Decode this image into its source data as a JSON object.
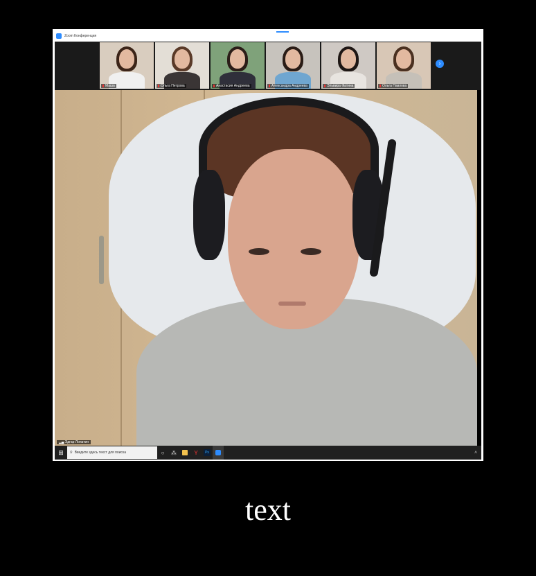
{
  "window": {
    "title": "Zoom Конференция"
  },
  "gallery": {
    "participants": [
      {
        "name": "Маша",
        "bg": "#d9cdbf",
        "shirt": "#f0f0f0",
        "hair": "#3b2418"
      },
      {
        "name": "Ольга Петрова",
        "bg": "#e3ded6",
        "shirt": "#3a3535",
        "hair": "#5a3a28"
      },
      {
        "name": "Анастасия Андреева",
        "bg": "#7fa27a",
        "shirt": "#2f2f3a",
        "hair": "#2b1d18"
      },
      {
        "name": "Александра Андреева",
        "bg": "#c7c3bd",
        "shirt": "#6fa6d0",
        "hair": "#2a1c16"
      },
      {
        "name": "Эльвира Фатина",
        "bg": "#cfc9c4",
        "shirt": "#e8e4e0",
        "hair": "#1e1614"
      },
      {
        "name": "Ольга Павлова",
        "bg": "#d8c7b6",
        "shirt": "#c5c0b8",
        "hair": "#4a3020"
      }
    ],
    "next_icon": "chevron-right-icon"
  },
  "main_video": {
    "speaker_name": "Эдгар Лопатин"
  },
  "taskbar": {
    "start_icon": "windows-start-icon",
    "search_placeholder": "Введите здесь текст для поиска",
    "icons": [
      {
        "name": "task-view-icon",
        "glyph": "○",
        "color": "#dddddd"
      },
      {
        "name": "widgets-icon",
        "glyph": "⁂",
        "color": "#dddddd"
      },
      {
        "name": "file-explorer-icon",
        "glyph": "",
        "color": "#f2c14e"
      },
      {
        "name": "yandex-browser-icon",
        "glyph": "Y",
        "color": "#ff3333"
      },
      {
        "name": "photoshop-icon",
        "glyph": "Ps",
        "color": "#31a8ff"
      },
      {
        "name": "zoom-icon",
        "glyph": "●",
        "color": "#2d8cff"
      }
    ],
    "tray_icon": "chevron-up-icon"
  },
  "caption": "text"
}
